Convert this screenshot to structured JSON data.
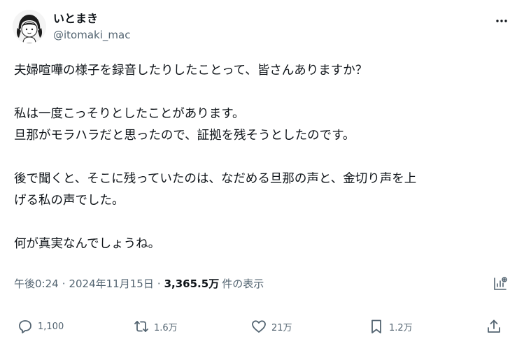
{
  "author": {
    "display_name": "いとまき",
    "handle": "@itomaki_mac"
  },
  "post": {
    "lines": [
      "夫婦喧嘩の様子を録音したりしたことって、皆さんありますか？",
      "",
      "私は一度こっそりとしたことがあります。",
      "旦那がモラハラだと思ったので、証拠を残そうとしたのです。",
      "",
      "後で聞くと、そこに残っていたのは、なだめる旦那の声と、金切り声を上",
      "げる私の声でした。",
      "",
      "何が真実なんでしょうね。"
    ]
  },
  "meta": {
    "time": "午後0:24",
    "separator": "·",
    "date": "2024年11月15日",
    "views_count": "3,365.5万",
    "views_label": "件の表示"
  },
  "actions": {
    "reply_count": "1,100",
    "repost_count": "1.6万",
    "like_count": "21万",
    "bookmark_count": "1.2万"
  },
  "icons": {
    "more": "more-icon",
    "analytics": "analytics-icon",
    "reply": "reply-icon",
    "repost": "repost-icon",
    "like": "like-icon",
    "bookmark": "bookmark-icon",
    "share": "share-icon"
  },
  "colors": {
    "text": "#0f1419",
    "secondary": "#536471",
    "background": "#ffffff"
  }
}
